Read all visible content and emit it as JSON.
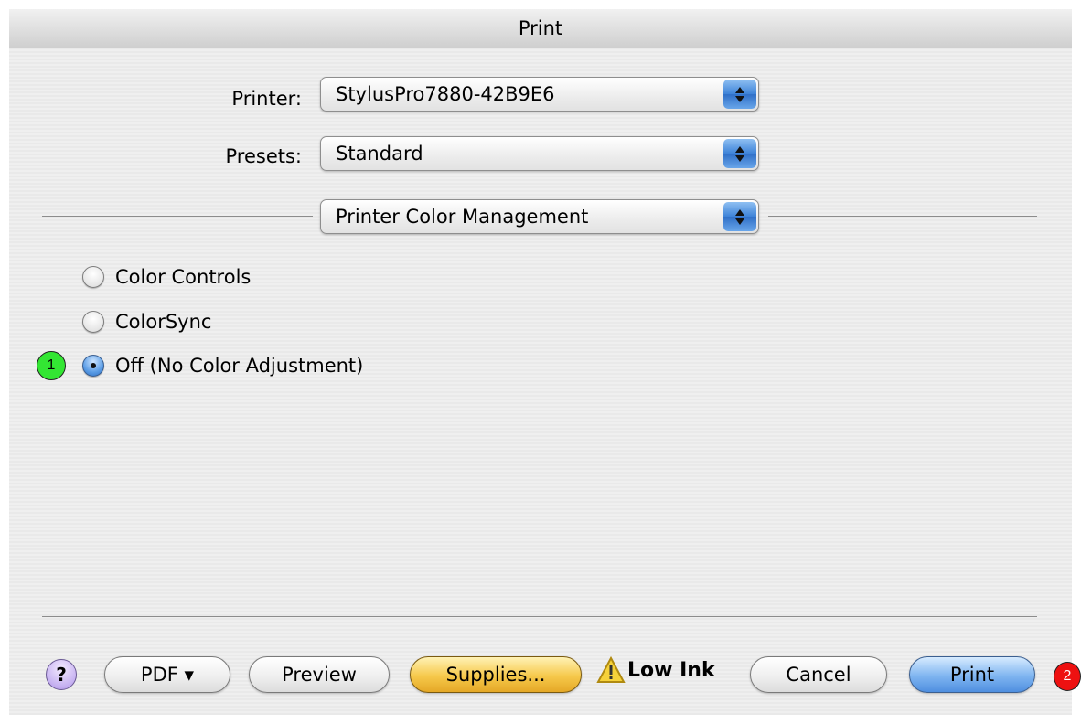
{
  "window": {
    "title": "Print"
  },
  "printer": {
    "label": "Printer:",
    "value": "StylusPro7880-42B9E6"
  },
  "presets": {
    "label": "Presets:",
    "value": "Standard"
  },
  "panel": {
    "value": "Printer Color Management"
  },
  "color_options": [
    {
      "label": "Color Controls",
      "selected": false
    },
    {
      "label": "ColorSync",
      "selected": false
    },
    {
      "label": "Off (No Color Adjustment)",
      "selected": true
    }
  ],
  "callouts": [
    {
      "number": "1",
      "color": "#33e633"
    },
    {
      "number": "2",
      "color": "#ee1111"
    }
  ],
  "buttons": {
    "help": "?",
    "pdf": "PDF ▾",
    "preview": "Preview",
    "supplies": "Supplies...",
    "low_ink": "Low Ink",
    "cancel": "Cancel",
    "print": "Print"
  },
  "icons": {
    "help": "question-icon",
    "warning": "warning-triangle-icon",
    "stepper": "up-down-arrows-icon"
  }
}
